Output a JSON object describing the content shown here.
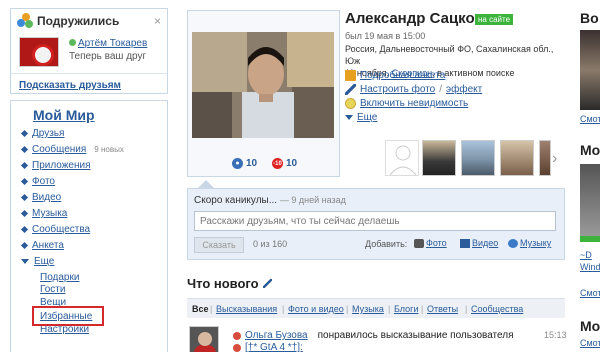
{
  "friends_widget": {
    "title": "Подружились",
    "friend_name": "Артём Токарев",
    "friend_sub": "Теперь ваш друг",
    "footer_link": "Подсказать друзьям",
    "close": "×"
  },
  "nav": {
    "title": "Мой Мир",
    "items": [
      {
        "label": "Друзья"
      },
      {
        "label": "Сообщения",
        "count": "9 новых"
      },
      {
        "label": "Приложения"
      },
      {
        "label": "Фото"
      },
      {
        "label": "Видео"
      },
      {
        "label": "Музыка"
      },
      {
        "label": "Сообщества"
      },
      {
        "label": "Анкета"
      },
      {
        "label": "Еще"
      }
    ],
    "subitems": [
      "Подарки",
      "Гости",
      "Вещи",
      "Избранные",
      "Настройки"
    ]
  },
  "profile": {
    "name": "Александр Сацков",
    "online_badge": "на сайте",
    "last_seen": "был 19 мая в 15:00",
    "location_line1": "Россия, Дальневосточный ФО, Сахалинская обл., Юж",
    "location_line2_prefix": "11 ноября,",
    "zodiac": "Скорпион",
    "location_line2_suffix": ", в активном поиске",
    "actions": {
      "full_profile": "Подробная анкета",
      "setup_photo": "Настроить фото",
      "effect": "эффект",
      "invisible": "Включить невидимость",
      "more": "Еще"
    },
    "rating_blue": "10",
    "rating_red": "10",
    "rating_red_icon": "-10"
  },
  "status": {
    "text": "Скоро каникулы...",
    "ago": "— 9 дней назад",
    "placeholder": "Расскажи друзьям, что ты сейчас делаешь",
    "button": "Сказать",
    "counter": "0 из 160",
    "add_label": "Добавить:",
    "add_photo": "Фото",
    "add_video": "Видео",
    "add_music": "Музыку"
  },
  "news": {
    "title": "Что нового",
    "tabs": [
      "Все",
      "Высказывания",
      "Фото и видео",
      "Музыка",
      "Блоги",
      "Ответы",
      "Сообщества"
    ],
    "feed": {
      "author": "Ольга Бузова",
      "action": "понравилось высказывание пользователя",
      "second_line": "[†* GtA 4  *†]:",
      "time": "15:13"
    }
  },
  "right_col": {
    "top": "Во",
    "t1": "Смот",
    "t2": "Мо",
    "t3": "~D",
    "t4": "Wind",
    "t5": "Смот",
    "t6": "Мо",
    "t7": "Смот"
  },
  "colors": {
    "accent": "#2a5b9a",
    "highlight": "#d42a2a",
    "online": "#3cb43c"
  }
}
